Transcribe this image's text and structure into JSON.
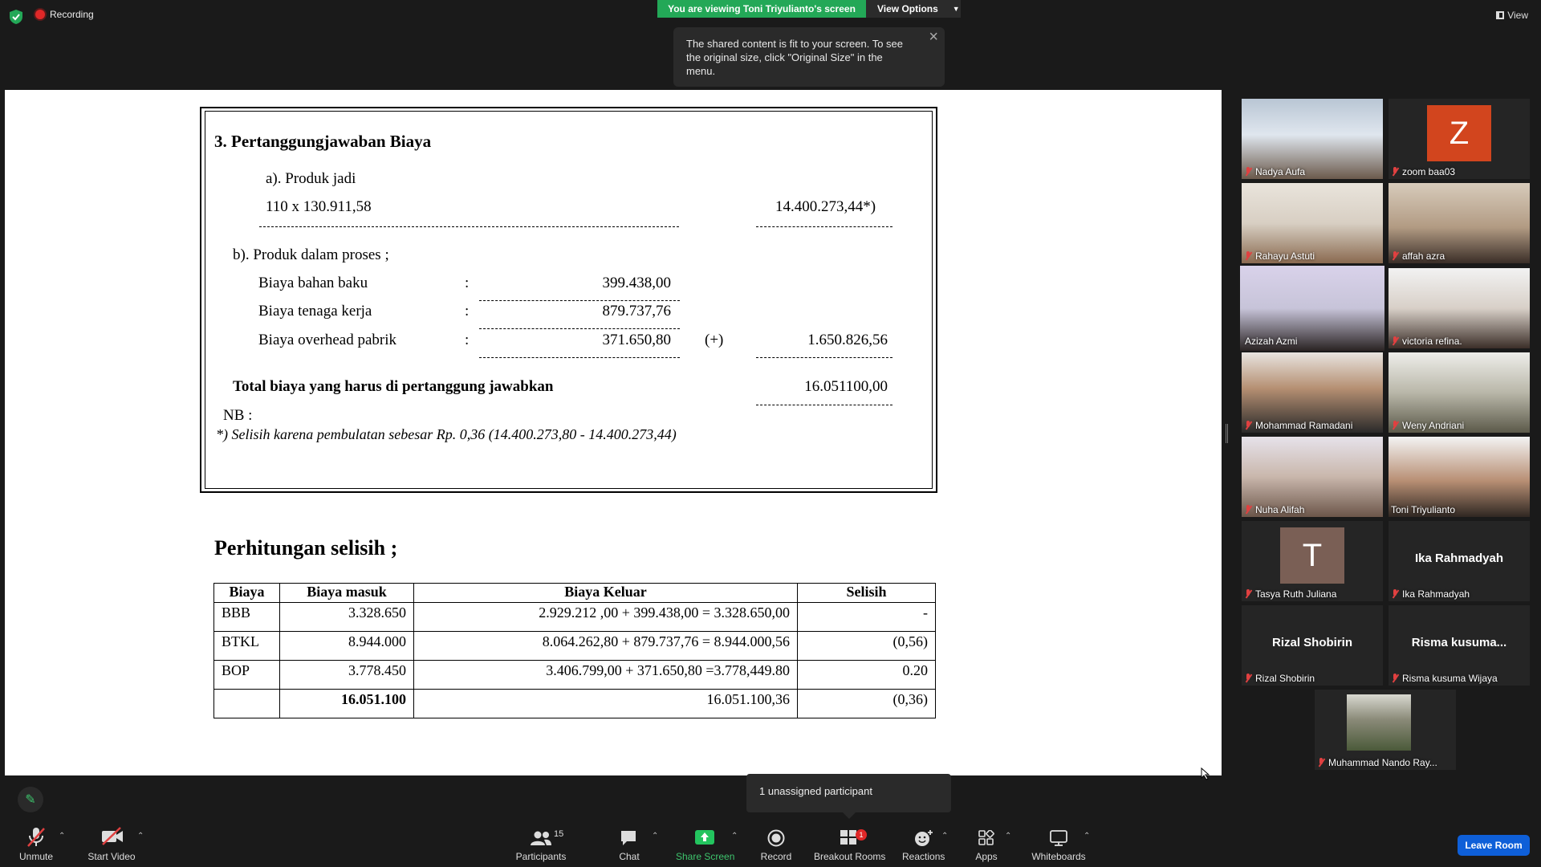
{
  "topbar": {
    "recording_label": "Recording",
    "viewing_banner": "You are viewing Toni Triyulianto's screen",
    "view_options_label": "View Options",
    "tooltip_text": "The shared content is fit to your screen. To see the original size, click \"Original Size\" in the menu.",
    "view_label": "View"
  },
  "document": {
    "section_title": "3.   Pertanggungjawaban  Biaya",
    "a_label": "a). Produk jadi",
    "a_formula": "110  x  130.911,58",
    "a_total": "14.400.273,44*)",
    "b_label": "b). Produk dalam proses ;",
    "rows": [
      {
        "label": "Biaya bahan baku",
        "colon": ":",
        "value": "399.438,00"
      },
      {
        "label": "Biaya tenaga kerja",
        "colon": ":",
        "value": "879.737,76"
      },
      {
        "label": "Biaya overhead pabrik",
        "colon": ":",
        "value": "371.650,80"
      }
    ],
    "plus_sign": "(+)",
    "b_total": "1.650.826,56",
    "total_label": "Total biaya yang harus di pertanggung jawabkan",
    "total_value": "16.051100,00",
    "nb_label": "NB :",
    "nb_note": "*)  Selisih karena pembulatan sebesar Rp. 0,36  (14.400.273,80  -  14.400.273,44)",
    "calc_title": "Perhitungan selisih ;",
    "table_headers": [
      "Biaya",
      "Biaya masuk",
      "Biaya Keluar",
      "Selisih"
    ],
    "table_rows": [
      {
        "biaya": "BBB",
        "masuk": "3.328.650",
        "keluar": "2.929.212 ,00  +  399.438,00  = 3.328.650,00",
        "selisih": "-"
      },
      {
        "biaya": "BTKL",
        "masuk": "8.944.000",
        "keluar": "8.064.262,80  + 879.737,76  = 8.944.000,56",
        "selisih": "(0,56)"
      },
      {
        "biaya": "BOP",
        "masuk": "3.778.450",
        "keluar": "3.406.799,00  + 371.650,80  =3.778,449.80",
        "selisih": "0.20"
      },
      {
        "biaya": "",
        "masuk": "16.051.100",
        "keluar": "16.051.100,36",
        "selisih": "(0,36)"
      }
    ]
  },
  "participants": [
    {
      "name": "Nadya Aufa"
    },
    {
      "name": "zoom baa03",
      "initial": "Z",
      "color": "#d2451e"
    },
    {
      "name": "Rahayu Astuti"
    },
    {
      "name": "affah azra"
    },
    {
      "name": "Azizah Azmi"
    },
    {
      "name": "victoria refina."
    },
    {
      "name": "Mohammad Ramadani"
    },
    {
      "name": "Weny Andriani"
    },
    {
      "name": "Nuha Alifah"
    },
    {
      "name": "Toni Triyulianto"
    },
    {
      "name": "Tasya Ruth Juliana",
      "initial": "T",
      "color": "#7a5f55"
    },
    {
      "name": "Ika Rahmadyah",
      "display": "Ika Rahmadyah"
    },
    {
      "name": "Rizal Shobirin",
      "display": "Rizal Shobirin"
    },
    {
      "name": "Risma kusuma Wijaya",
      "display": "Risma  kusuma..."
    },
    {
      "name": "Muhammad Nando Ray..."
    }
  ],
  "toolbar": {
    "unmute": "Unmute",
    "start_video": "Start Video",
    "participants": "Participants",
    "participants_count": "15",
    "chat": "Chat",
    "share_screen": "Share Screen",
    "record": "Record",
    "breakout_rooms": "Breakout Rooms",
    "breakout_badge": "1",
    "reactions": "Reactions",
    "apps": "Apps",
    "whiteboards": "Whiteboards",
    "leave": "Leave Room",
    "unassigned_popup": "1 unassigned participant"
  },
  "colors": {
    "accent_green": "#23a857",
    "leave_blue": "#0e5fd8",
    "active_speaker": "#e8e84a",
    "mute_red": "#e04040"
  }
}
